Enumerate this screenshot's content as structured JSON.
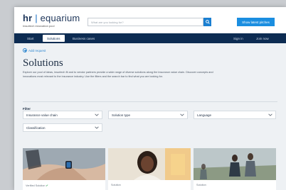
{
  "brand": {
    "logo_hr": "hr",
    "logo_separator": "|",
    "logo_rest": "equarium",
    "tagline": "Insurtech innovation pool"
  },
  "search": {
    "placeholder": "What are you looking for?"
  },
  "header_cta": "Show latest pitches",
  "nav": {
    "items": [
      {
        "label": "Start"
      },
      {
        "label": "Solutions"
      },
      {
        "label": "Business cases"
      }
    ],
    "right": [
      {
        "label": "Sign in"
      },
      {
        "label": "Join now"
      }
    ]
  },
  "add_request": "Add request",
  "page_title": "Solutions",
  "description": "Explore our pool of ideas, insurtech fit and to vendor partners provide a wide range of diverse solutions along the insurance value chain. Discover concepts and innovations most relevant to the insurance industry. Use the filters and the search bar to find what you are looking for.",
  "filter": {
    "label": "Filter",
    "dropdowns": [
      {
        "label": "Insurance value chain"
      },
      {
        "label": "Solution type"
      },
      {
        "label": "Language"
      },
      {
        "label": "Classification"
      }
    ]
  },
  "cards": [
    {
      "label": "Verified Solution",
      "verified": true
    },
    {
      "label": "Solution",
      "verified": false
    },
    {
      "label": "Solution",
      "verified": false
    }
  ],
  "colors": {
    "nav_bg": "#0d2c52",
    "accent": "#1b8ee0",
    "page_bg": "#eef1f4"
  }
}
